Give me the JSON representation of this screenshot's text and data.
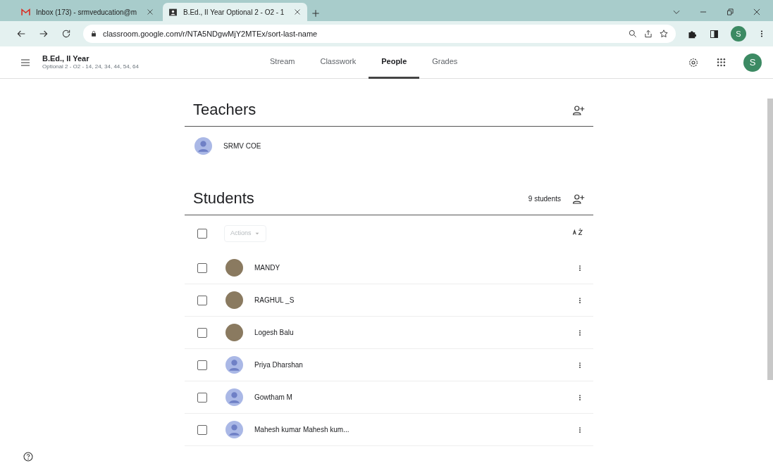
{
  "browser": {
    "tabs": [
      {
        "title": "Inbox (173) - srmveducation@m",
        "selected": false,
        "kind": "mail"
      },
      {
        "title": "B.Ed., II Year Optional 2 - O2 - 1",
        "selected": true,
        "kind": "classroom"
      }
    ],
    "url": "classroom.google.com/r/NTA5NDgwMjY2MTEx/sort-last-name",
    "profile_initial": "S"
  },
  "app": {
    "class_name": "B.Ed., II Year",
    "class_section": "Optional 2 - O2 - 14, 24, 34, 44, 54, 64",
    "nav_tabs": [
      {
        "label": "Stream",
        "selected": false
      },
      {
        "label": "Classwork",
        "selected": false
      },
      {
        "label": "People",
        "selected": true
      },
      {
        "label": "Grades",
        "selected": false
      }
    ],
    "account_initial": "S"
  },
  "teachers": {
    "heading": "Teachers",
    "members": [
      {
        "name": "SRMV COE",
        "kind": "default"
      }
    ]
  },
  "students": {
    "heading": "Students",
    "count": "9 students",
    "actions_label": "Actions",
    "select_all_checked": false,
    "members": [
      {
        "name": "MANDY",
        "kind": "photo",
        "checked": false
      },
      {
        "name": "RAGHUL _S",
        "kind": "photo",
        "checked": false
      },
      {
        "name": "Logesh Balu",
        "kind": "photo",
        "checked": false
      },
      {
        "name": "Priya Dharshan",
        "kind": "default",
        "checked": false
      },
      {
        "name": "Gowtham M",
        "kind": "default",
        "checked": false
      },
      {
        "name": "Mahesh kumar Mahesh kum...",
        "kind": "default",
        "checked": false
      }
    ]
  }
}
